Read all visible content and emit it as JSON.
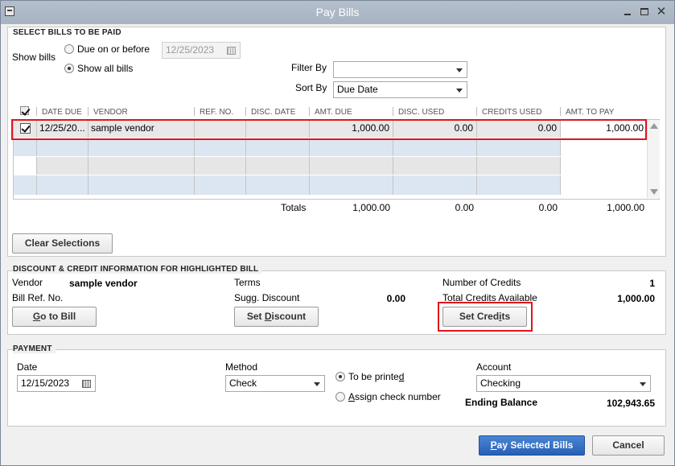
{
  "window": {
    "title": "Pay Bills",
    "minimize": "",
    "maximize": "",
    "close": "✕"
  },
  "select_bills": {
    "section_title": "SELECT BILLS TO BE PAID",
    "show_bills_label": "Show bills",
    "due_on_before_label": "Due on or before",
    "due_date_value": "12/25/2023",
    "show_all_label": "Show all bills",
    "selected_option": "show_all",
    "filter_by_label": "Filter By",
    "filter_by_value": "",
    "sort_by_label": "Sort By",
    "sort_by_value": "Due Date"
  },
  "table": {
    "columns": [
      "DATE DUE",
      "VENDOR",
      "REF. NO.",
      "DISC. DATE",
      "AMT. DUE",
      "DISC. USED",
      "CREDITS USED",
      "AMT. TO PAY"
    ],
    "rows": [
      {
        "checked": true,
        "date_due": "12/25/20...",
        "vendor": "sample vendor",
        "ref_no": "",
        "disc_date": "",
        "amt_due": "1,000.00",
        "disc_used": "0.00",
        "credits_used": "0.00",
        "amt_to_pay": "1,000.00"
      }
    ],
    "totals": {
      "label": "Totals",
      "amt_due": "1,000.00",
      "disc_used": "0.00",
      "credits_used": "0.00",
      "amt_to_pay": "1,000.00"
    },
    "clear_selections_label": "Clear Selections"
  },
  "discount_credit": {
    "section_title": "DISCOUNT & CREDIT INFORMATION FOR HIGHLIGHTED BILL",
    "vendor_label": "Vendor",
    "vendor_value": "sample vendor",
    "bill_ref_label": "Bill Ref. No.",
    "terms_label": "Terms",
    "terms_value": "",
    "sugg_discount_label": "Sugg. Discount",
    "sugg_discount_value": "0.00",
    "num_credits_label": "Number of Credits",
    "num_credits_value": "1",
    "total_credits_label": "Total Credits Available",
    "total_credits_value": "1,000.00",
    "go_to_bill": {
      "pre": "",
      "u": "G",
      "post": "o to Bill"
    },
    "set_discount": {
      "pre": "Set ",
      "u": "D",
      "post": "iscount"
    },
    "set_credits": {
      "pre": "Set Cred",
      "u": "i",
      "post": "ts"
    }
  },
  "payment": {
    "section_title": "PAYMENT",
    "date_label": "Date",
    "date_value": "12/15/2023",
    "method_label": "Method",
    "method_value": "Check",
    "to_be_printed": {
      "pre": "To be printe",
      "u": "d",
      "post": ""
    },
    "assign_check": {
      "pre": "",
      "u": "A",
      "post": "ssign check number"
    },
    "selected_option": "to_be_printed",
    "account_label": "Account",
    "account_value": "Checking",
    "ending_balance_label": "Ending Balance",
    "ending_balance_value": "102,943.65"
  },
  "actions": {
    "pay_selected": {
      "pre": "",
      "u": "P",
      "post": "ay Selected Bills"
    },
    "cancel_label": "Cancel"
  },
  "colors": {
    "highlight": "#e0141e",
    "row_selected": "#e6e6e6",
    "row_alt": "#d4dfee",
    "primary": "#2f6bc0"
  }
}
